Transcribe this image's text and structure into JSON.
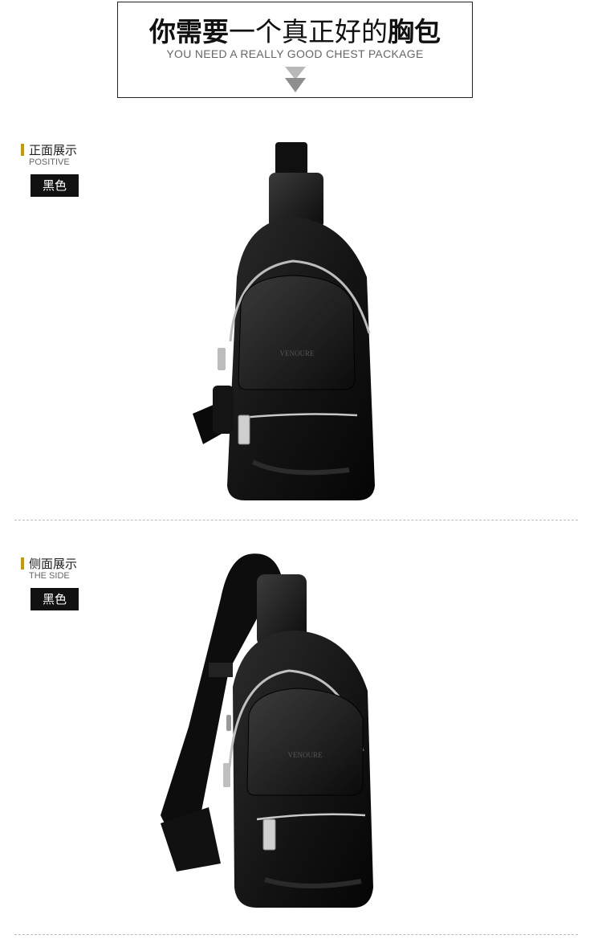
{
  "hero": {
    "title_bold_1": "你需要",
    "title_light": "一个真正好的",
    "title_bold_2": "胸包",
    "subtitle": "YOU NEED A REALLY GOOD CHEST PACKAGE",
    "arrow_icon": "double-chevron-down-icon"
  },
  "sections": [
    {
      "title_cn": "正面展示",
      "title_en": "POSITIVE",
      "color_label": "黑色",
      "brand_text": "VENOURE"
    },
    {
      "title_cn": "侧面展示",
      "title_en": "THE SIDE",
      "color_label": "黑色",
      "brand_text": "VENOURE"
    }
  ],
  "colors": {
    "accent_bar": "#c79a00",
    "tag_bg": "#111111",
    "bag_leather": "#111111"
  }
}
